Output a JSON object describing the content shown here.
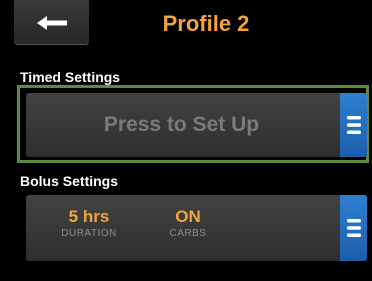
{
  "header": {
    "title": "Profile 2",
    "back_icon": "left-arrow-icon"
  },
  "timed_settings": {
    "label": "Timed Settings",
    "button_text": "Press to Set Up",
    "menu_icon": "menu-icon"
  },
  "bolus_settings": {
    "label": "Bolus Settings",
    "duration_value": "5 hrs",
    "duration_label": "DURATION",
    "carbs_value": "ON",
    "carbs_label": "CARBS",
    "menu_icon": "menu-icon"
  },
  "colors": {
    "accent_orange": "#f2a43a",
    "menu_blue": "#2f7fd1",
    "selection_green": "#5d8a3d"
  }
}
